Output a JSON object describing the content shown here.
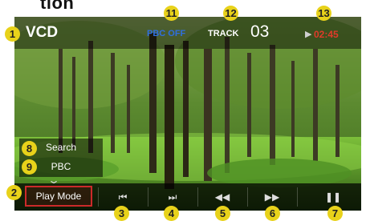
{
  "heading_fragment": "tion",
  "header": {
    "source": "VCD",
    "pbc_status": "PBC OFF",
    "track_label": "TRACK",
    "track_number": "03",
    "play_indicator_icon": "play-icon",
    "elapsed_time": "02:45"
  },
  "side_menu": {
    "search_label": "Search",
    "pbc_label": "PBC",
    "expand_icon": "chevron-down-icon"
  },
  "controls": {
    "play_mode_label": "Play Mode",
    "prev_icon": "skip-previous-icon",
    "next_icon": "skip-next-icon",
    "rewind_icon": "rewind-icon",
    "forward_icon": "fast-forward-icon",
    "pause_icon": "pause-icon"
  },
  "callouts": [
    "1",
    "2",
    "3",
    "4",
    "5",
    "6",
    "7",
    "8",
    "9",
    "11",
    "12",
    "13"
  ],
  "colors": {
    "pbc_off": "#2f6fe0",
    "time": "#e03a2a",
    "callout": "#e8d21a",
    "play_mode_border": "#cc2a2a"
  }
}
